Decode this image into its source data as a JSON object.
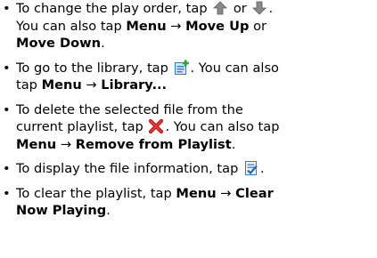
{
  "items": [
    {
      "l1_a": "To change the play order, tap ",
      "l1_or": " or ",
      "l1_end": ".",
      "l2_a": "You can also tap ",
      "l2_b1": "Menu",
      "arrow": "→",
      "l2_b2": "Move Up",
      "l2_or": " or",
      "l3_b": "Move Down",
      "l3_end": "."
    },
    {
      "l1_a": "To go to the library, tap ",
      "l1_end": ". You can also",
      "l2_a": "tap ",
      "l2_b1": "Menu",
      "arrow": "→",
      "l2_b2": "Library..."
    },
    {
      "l1": "To delete the selected file from the",
      "l2_a": "current playlist, tap ",
      "l2_end": ". You can also tap",
      "l3_b1": "Menu",
      "arrow": "→",
      "l3_b2": "Remove from Playlist",
      "l3_end": "."
    },
    {
      "l1_a": "To display the file information, tap ",
      "l1_end": "."
    },
    {
      "l1_a": "To clear the playlist, tap ",
      "l1_b1": "Menu",
      "arrow": "→",
      "l1_b2": "Clear",
      "l2_b": "Now Playing",
      "l2_end": "."
    }
  ],
  "bullet": "•",
  "icons": [
    "move-up-arrow-icon",
    "move-down-arrow-icon",
    "library-add-icon",
    "remove-red-x-icon",
    "file-info-icon"
  ]
}
